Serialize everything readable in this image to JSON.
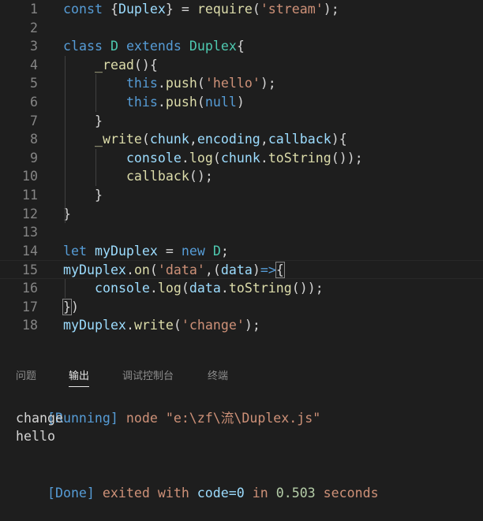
{
  "editor": {
    "lines": [
      {
        "n": "1",
        "t": [
          [
            "kw",
            "const "
          ],
          [
            "pun",
            "{"
          ],
          [
            "var",
            "Duplex"
          ],
          [
            "pun",
            "} = "
          ],
          [
            "fn",
            "require"
          ],
          [
            "pun",
            "("
          ],
          [
            "str",
            "'stream'"
          ],
          [
            "pun",
            ");"
          ]
        ]
      },
      {
        "n": "2",
        "t": []
      },
      {
        "n": "3",
        "t": [
          [
            "kw",
            "class "
          ],
          [
            "cls",
            "D "
          ],
          [
            "kw",
            "extends "
          ],
          [
            "cls",
            "Duplex"
          ],
          [
            "pun",
            "{"
          ]
        ]
      },
      {
        "n": "4",
        "t": [
          [
            "pun",
            "    "
          ],
          [
            "fn",
            "_read"
          ],
          [
            "pun",
            "(){"
          ]
        ]
      },
      {
        "n": "5",
        "t": [
          [
            "pun",
            "        "
          ],
          [
            "kw",
            "this"
          ],
          [
            "pun",
            "."
          ],
          [
            "fn",
            "push"
          ],
          [
            "pun",
            "("
          ],
          [
            "str",
            "'hello'"
          ],
          [
            "pun",
            ");"
          ]
        ]
      },
      {
        "n": "6",
        "t": [
          [
            "pun",
            "        "
          ],
          [
            "kw",
            "this"
          ],
          [
            "pun",
            "."
          ],
          [
            "fn",
            "push"
          ],
          [
            "pun",
            "("
          ],
          [
            "kw",
            "null"
          ],
          [
            "pun",
            ")"
          ]
        ]
      },
      {
        "n": "7",
        "t": [
          [
            "pun",
            "    }"
          ]
        ]
      },
      {
        "n": "8",
        "t": [
          [
            "pun",
            "    "
          ],
          [
            "fn",
            "_write"
          ],
          [
            "pun",
            "("
          ],
          [
            "var",
            "chunk"
          ],
          [
            "pun",
            ","
          ],
          [
            "var",
            "encoding"
          ],
          [
            "pun",
            ","
          ],
          [
            "var",
            "callback"
          ],
          [
            "pun",
            "){"
          ]
        ]
      },
      {
        "n": "9",
        "t": [
          [
            "pun",
            "        "
          ],
          [
            "var",
            "console"
          ],
          [
            "pun",
            "."
          ],
          [
            "fn",
            "log"
          ],
          [
            "pun",
            "("
          ],
          [
            "var",
            "chunk"
          ],
          [
            "pun",
            "."
          ],
          [
            "fn",
            "toString"
          ],
          [
            "pun",
            "());"
          ]
        ]
      },
      {
        "n": "10",
        "t": [
          [
            "pun",
            "        "
          ],
          [
            "fn",
            "callback"
          ],
          [
            "pun",
            "();"
          ]
        ]
      },
      {
        "n": "11",
        "t": [
          [
            "pun",
            "    }"
          ]
        ]
      },
      {
        "n": "12",
        "t": [
          [
            "pun",
            "}"
          ]
        ]
      },
      {
        "n": "13",
        "t": []
      },
      {
        "n": "14",
        "t": [
          [
            "kw",
            "let "
          ],
          [
            "var",
            "myDuplex"
          ],
          [
            "pun",
            " = "
          ],
          [
            "kw",
            "new "
          ],
          [
            "cls",
            "D"
          ],
          [
            "pun",
            ";"
          ]
        ]
      },
      {
        "n": "15",
        "t": [
          [
            "var",
            "myDuplex"
          ],
          [
            "pun",
            "."
          ],
          [
            "fn",
            "on"
          ],
          [
            "pun",
            "("
          ],
          [
            "str",
            "'data'"
          ],
          [
            "pun",
            ",("
          ],
          [
            "var",
            "data"
          ],
          [
            "pun",
            ")"
          ],
          [
            "kw",
            "=>"
          ],
          [
            "bm",
            "{"
          ]
        ]
      },
      {
        "n": "16",
        "t": [
          [
            "pun",
            "    "
          ],
          [
            "var",
            "console"
          ],
          [
            "pun",
            "."
          ],
          [
            "fn",
            "log"
          ],
          [
            "pun",
            "("
          ],
          [
            "var",
            "data"
          ],
          [
            "pun",
            "."
          ],
          [
            "fn",
            "toString"
          ],
          [
            "pun",
            "());"
          ]
        ]
      },
      {
        "n": "17",
        "t": [
          [
            "bm",
            "}"
          ],
          [
            "pun",
            ")"
          ]
        ]
      },
      {
        "n": "18",
        "t": [
          [
            "var",
            "myDuplex"
          ],
          [
            "pun",
            "."
          ],
          [
            "fn",
            "write"
          ],
          [
            "pun",
            "("
          ],
          [
            "str",
            "'change'"
          ],
          [
            "pun",
            ");"
          ]
        ]
      }
    ]
  },
  "panel": {
    "tabs": [
      "问题",
      "输出",
      "调试控制台",
      "终端"
    ],
    "active_tab": "输出",
    "output": {
      "running_tag": "[Running]",
      "running_cmd": " node \"e:\\zf\\流\\Duplex.js\"",
      "lines": [
        "change",
        "hello"
      ],
      "done_tag": "[Done]",
      "done_msg_1": " exited with ",
      "done_code": "code=0",
      "done_msg_2": " in ",
      "done_time": "0.503",
      "done_msg_3": " seconds"
    }
  },
  "colors": {
    "background": "#1e1e1e",
    "keyword": "#569cd6",
    "function": "#dcdcaa",
    "variable": "#9cdcfe",
    "class": "#4ec9b0",
    "string": "#ce9178",
    "text": "#d4d4d4",
    "line_number": "#858585",
    "output_tag": "#569cd6",
    "output_done_text": "#ce9178"
  }
}
